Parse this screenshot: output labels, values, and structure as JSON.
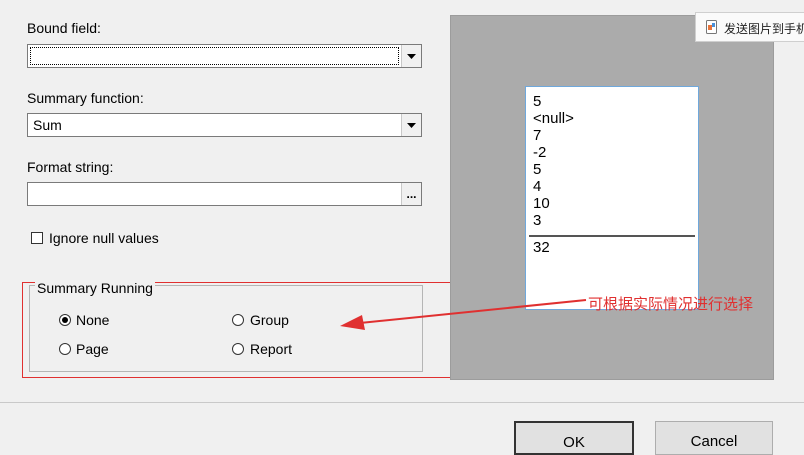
{
  "form": {
    "bound_field_label": "Bound field:",
    "bound_field_value": "",
    "summary_function_label": "Summary function:",
    "summary_function_value": "Sum",
    "format_string_label": "Format string:",
    "format_string_value": "",
    "format_button": "...",
    "ignore_nulls_label": "Ignore null values",
    "ignore_nulls_checked": false
  },
  "summary_running": {
    "title": "Summary Running",
    "options": [
      {
        "label": "None",
        "selected": true
      },
      {
        "label": "Group",
        "selected": false
      },
      {
        "label": "Page",
        "selected": false
      },
      {
        "label": "Report",
        "selected": false
      }
    ]
  },
  "preview": {
    "values": [
      "5",
      "<null>",
      "7",
      "-2",
      "5",
      "4",
      "10",
      "3"
    ],
    "total": "32"
  },
  "annotation_text": "可根据实际情况进行选择",
  "send_to_phone_label": "发送图片到手机",
  "buttons": {
    "ok": "OK",
    "cancel": "Cancel"
  },
  "colors": {
    "annotation_red": "#e03030",
    "preview_gray": "#ababab",
    "dialog_bg": "#f0f0f0"
  }
}
